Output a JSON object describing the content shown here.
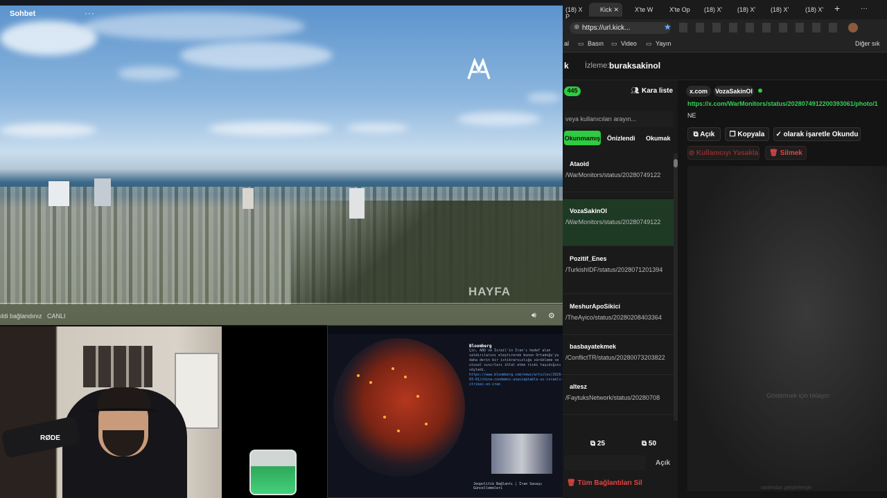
{
  "video": {
    "chat_title": "Sohbet",
    "more": "···",
    "watermark": "HAYFA",
    "left_status": "ıldi bağlandınız",
    "live_label": "CANLI",
    "volume_icon": "volume-icon",
    "settings_icon": "gear-icon"
  },
  "webcam": {
    "mic_brand": "RØDE"
  },
  "browser": {
    "tabs": [
      "(18) X P",
      "Kick",
      "X'te W",
      "X'te Op",
      "(18) X'",
      "(18) X'",
      "(18) X'",
      "(18) X'"
    ],
    "new_tab": "+",
    "menu": "···",
    "url": "https://url.kick...",
    "bookmarks": [
      "al",
      "Basın",
      "Video",
      "Yayın"
    ],
    "other_bookmarks": "Diğer sık"
  },
  "app": {
    "brand": "k",
    "watching_label": "İzleme:",
    "watching_user": "buraksakinol",
    "count_badge": "445",
    "blacklist_label": "Kara liste",
    "search_placeholder": "veya kullanıcıları arayın...",
    "filter_tabs": [
      "Okunmamış",
      "Önizlendi",
      "Okumak"
    ],
    "rows": [
      {
        "name": "Ataoid",
        "status": "/WarMonitors/status/20280749122"
      },
      {
        "name": "VozaSakinOl",
        "status": "/WarMonitors/status/20280749122"
      },
      {
        "name": "Pozitif_Enes",
        "status": "/TurkishIDF/status/2028071201394"
      },
      {
        "name": "MeshurApoSikici",
        "status": "/TheAyico/status/20280208403364"
      },
      {
        "name": "basbayatekmek",
        "status": "/ConflictTR/status/20280073203822"
      },
      {
        "name": "altesz",
        "status": "/FaytuksNetwork/status/20280708"
      }
    ],
    "page_btns": [
      "25",
      "50"
    ],
    "open_label": "Açık",
    "delete_all": "Tüm Bağlantıları Sil",
    "detail": {
      "source_chip": "x.com",
      "user_chip": "VozaSakinOl",
      "link": "https://x.com/WarMonitors/status/2028074912200393061/photo/1",
      "message": "NE",
      "btn_open": "Açık",
      "btn_copy": "Kopyala",
      "btn_mark": "olarak işaretle Okundu",
      "btn_ban": "Kullanıcıyı Yasakla",
      "btn_delete": "Silmek",
      "preview_hint": "Göstermek için tıklayın",
      "footer": "tarafından geliştirilmiştir"
    }
  },
  "dashboard": {
    "feed_title": "Bloomberg",
    "feed_text": "Çin, ABD ve İsrail'in İran'ı hedef alan saldırılarını eleştirerek bunun Ortadoğu'yu daha derin bir istikrarsızlığa sürükleme ve ulusal sınırları ihlal etme riski taşıdığını söyledi.",
    "feed_link": "https://www.bloomberg.com/news/articles/2026-03-01/china-condemns-unacceptable-us-israeli-strikes-on-iran",
    "feed_footer": "Jeopolitik Bağlantı | İran Savaşı Güncellemeleri"
  },
  "colors": {
    "accent_green": "#2ecc40",
    "link_green": "#34d058",
    "danger": "#e04545"
  }
}
